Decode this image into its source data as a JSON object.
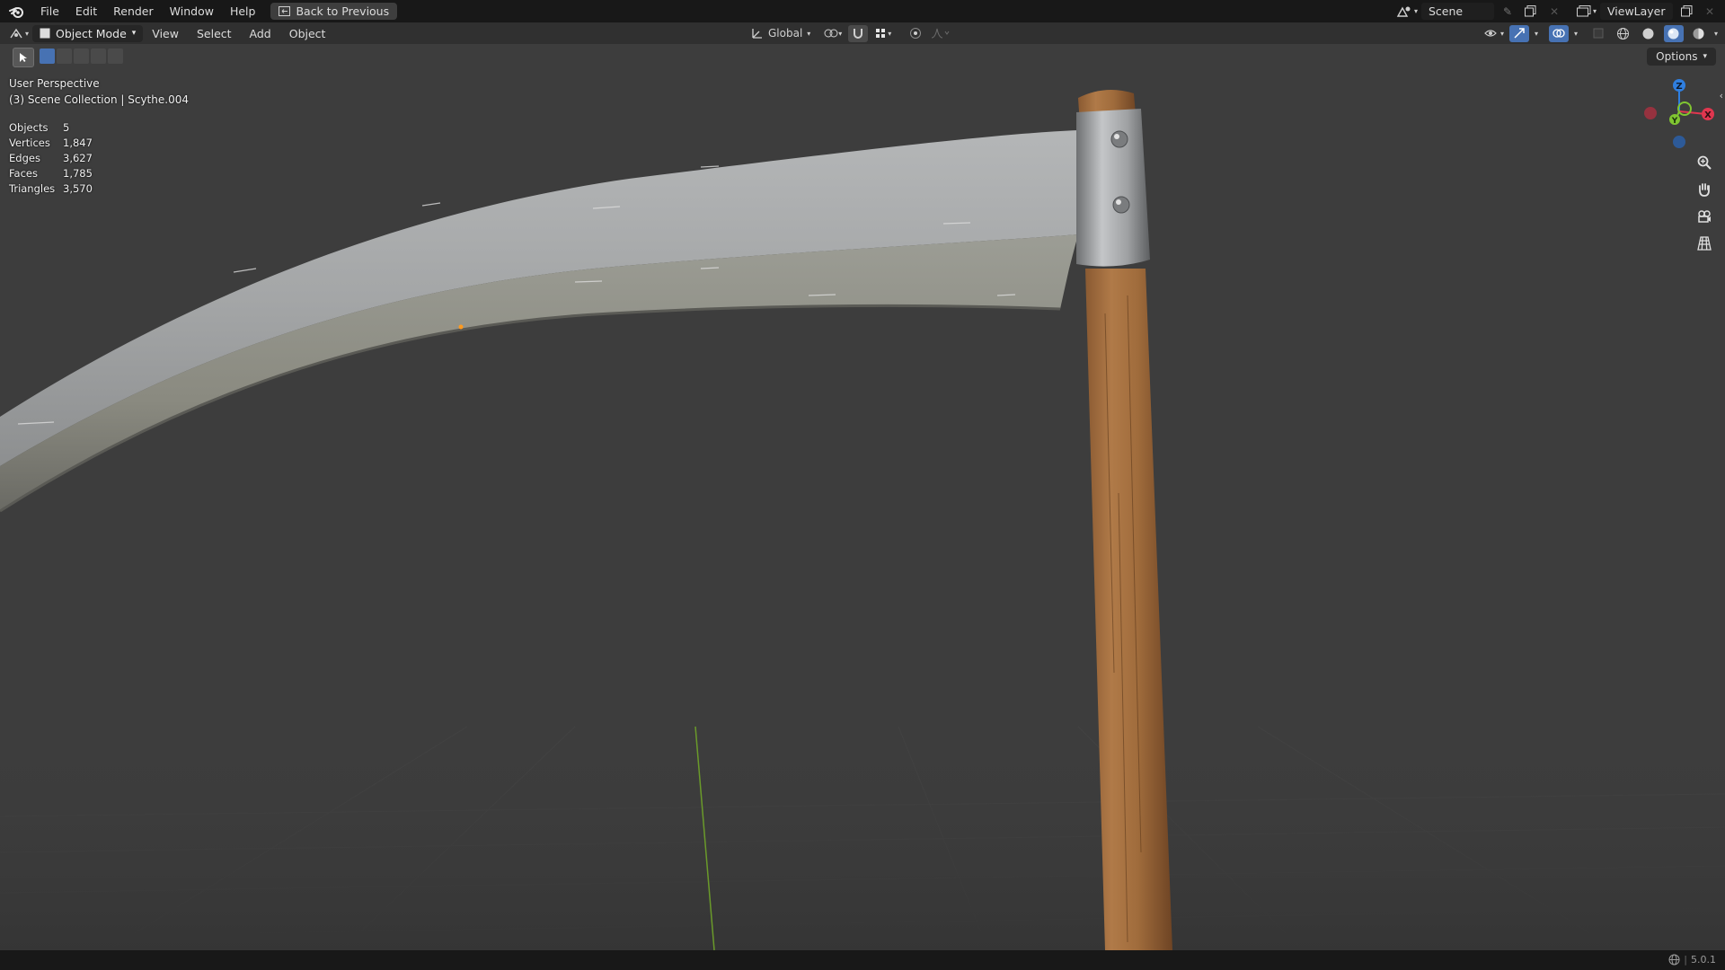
{
  "menu": {
    "items": [
      "File",
      "Edit",
      "Render",
      "Window",
      "Help"
    ],
    "back_button": "Back to Previous"
  },
  "topright": {
    "scene_name": "Scene",
    "view_layer": "ViewLayer"
  },
  "header": {
    "mode": "Object Mode",
    "menus": [
      "View",
      "Select",
      "Add",
      "Object"
    ],
    "transform_orientation": "Global"
  },
  "options_label": "Options",
  "viewport": {
    "perspective": "User Perspective",
    "collection": "(3) Scene Collection | Scythe.004",
    "stats": [
      {
        "label": "Objects",
        "value": "5"
      },
      {
        "label": "Vertices",
        "value": "1,847"
      },
      {
        "label": "Edges",
        "value": "3,627"
      },
      {
        "label": "Faces",
        "value": "1,785"
      },
      {
        "label": "Triangles",
        "value": "3,570"
      }
    ]
  },
  "gizmo": {
    "z": "Z",
    "y": "Y",
    "x": "X"
  },
  "status": {
    "version": "5.0.1"
  },
  "colors": {
    "axis_x": "#e0364f",
    "axis_y": "#80c531",
    "axis_z": "#2f7fe0",
    "active_blue": "#4772b3"
  },
  "icons": [
    "blender-logo-icon",
    "editor-type-icon",
    "select-box-icon",
    "zoom-icon",
    "hand-icon",
    "camera-icon",
    "grid-icon",
    "globe-icon"
  ]
}
